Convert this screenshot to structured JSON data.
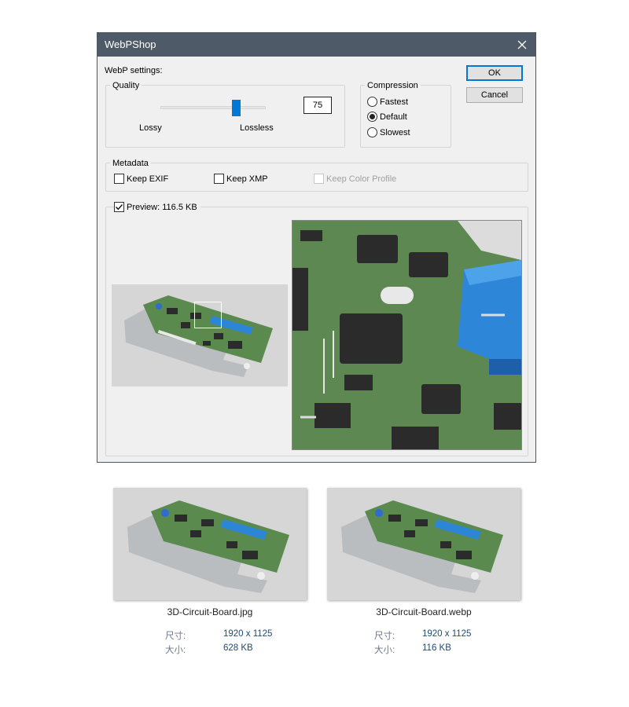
{
  "dialog": {
    "title": "WebPShop",
    "settings_label": "WebP settings:",
    "ok_label": "OK",
    "cancel_label": "Cancel",
    "quality": {
      "legend": "Quality",
      "value": "75",
      "level": 0.75,
      "lossy_label": "Lossy",
      "lossless_label": "Lossless"
    },
    "compression": {
      "legend": "Compression",
      "options": [
        "Fastest",
        "Default",
        "Slowest"
      ],
      "selected": "Default"
    },
    "metadata": {
      "legend": "Metadata",
      "keep_exif": "Keep EXIF",
      "keep_xmp": "Keep XMP",
      "keep_color_profile": "Keep Color Profile"
    },
    "preview": {
      "label": "Preview: 116.5 KB",
      "checked": true
    }
  },
  "files": [
    {
      "name": "3D-Circuit-Board.jpg",
      "size_key": "尺寸:",
      "size_value": "1920 x 1125",
      "weight_key": "大小:",
      "weight_value": "628 KB"
    },
    {
      "name": "3D-Circuit-Board.webp",
      "size_key": "尺寸:",
      "size_value": "1920 x 1125",
      "weight_key": "大小:",
      "weight_value": "116 KB"
    }
  ],
  "colors": {
    "titlebar": "#4e5a67",
    "accent": "#0078d7",
    "board_green": "#5e8851",
    "connector_blue": "#2f86d6"
  }
}
